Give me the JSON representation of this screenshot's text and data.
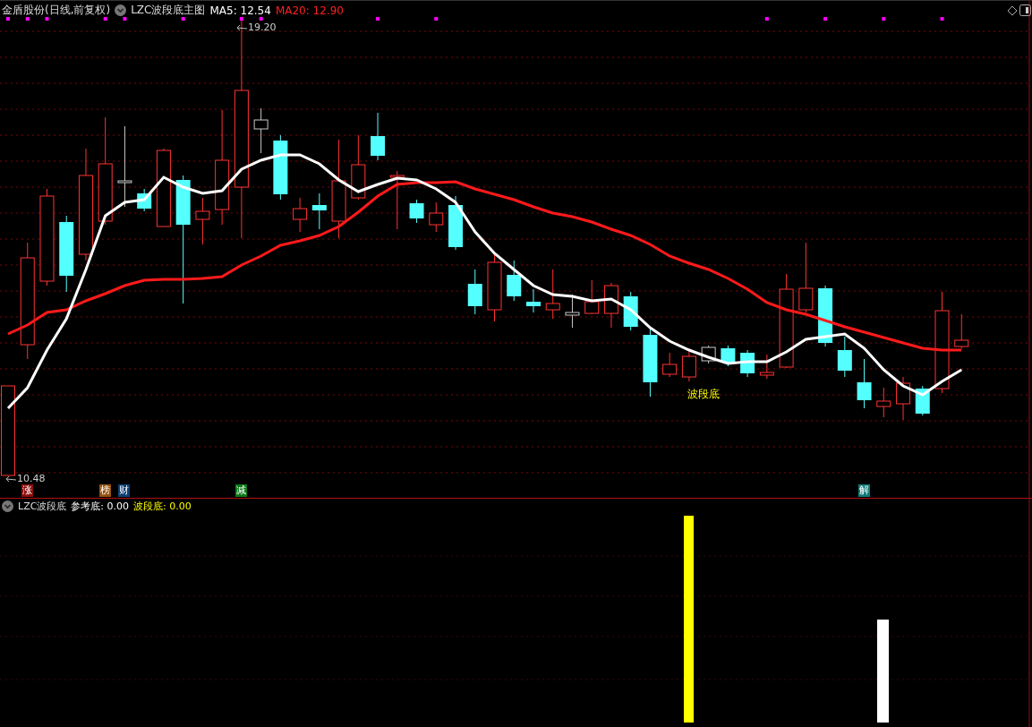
{
  "header": {
    "stock": "金盾股份(日线,前复权)",
    "indicator": "LZC波段底主图",
    "ma5": "MA5: 12.54",
    "ma20": "MA20: 12.90"
  },
  "price_marks": [
    {
      "kind": "high",
      "label": "19.20"
    },
    {
      "kind": "low",
      "label": "10.48"
    }
  ],
  "chart_annotation": "波段底",
  "event_tags": [
    {
      "label": "涨",
      "color": "#8a0c0c"
    },
    {
      "label": "榜",
      "color": "#93500f"
    },
    {
      "label": "财",
      "color": "#0d3f72"
    },
    {
      "label": "减",
      "color": "#0d7a1a"
    },
    {
      "label": "解",
      "color": "#0e7b78"
    }
  ],
  "sub_panel": {
    "title": "LZC波段底",
    "reference": "参考底: 0.00",
    "signal": "波段底: 0.00"
  }
}
